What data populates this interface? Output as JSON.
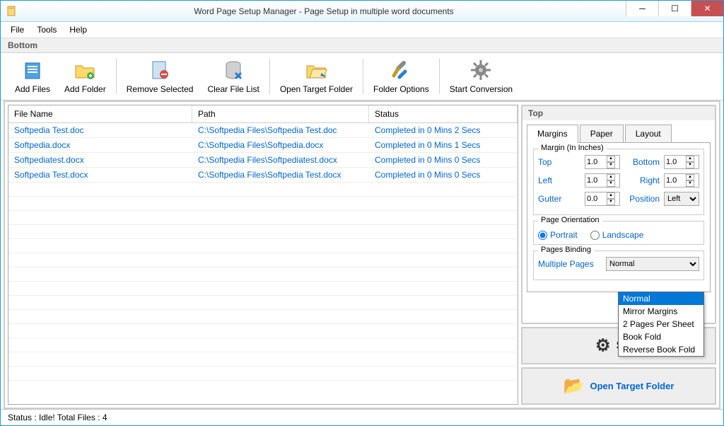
{
  "window": {
    "title": "Word Page Setup Manager - Page Setup in multiple word documents"
  },
  "menu": {
    "file": "File",
    "tools": "Tools",
    "help": "Help"
  },
  "section": {
    "bottom": "Bottom",
    "top": "Top"
  },
  "toolbar": {
    "add_files": "Add Files",
    "add_folder": "Add Folder",
    "remove_selected": "Remove Selected",
    "clear_file_list": "Clear File List",
    "open_target_folder": "Open Target Folder",
    "folder_options": "Folder Options",
    "start_conversion": "Start Conversion"
  },
  "grid": {
    "headers": {
      "file_name": "File Name",
      "path": "Path",
      "status": "Status"
    },
    "rows": [
      {
        "file": "Softpedia Test.doc",
        "path": "C:\\Softpedia Files\\Softpedia Test.doc",
        "status": "Completed in 0 Mins 2 Secs"
      },
      {
        "file": "Softpedia.docx",
        "path": "C:\\Softpedia Files\\Softpedia.docx",
        "status": "Completed in 0 Mins 1 Secs"
      },
      {
        "file": "Softpediatest.docx",
        "path": "C:\\Softpedia Files\\Softpediatest.docx",
        "status": "Completed in 0 Mins 0 Secs"
      },
      {
        "file": "Softpedia Test.docx",
        "path": "C:\\Softpedia Files\\Softpedia Test.docx",
        "status": "Completed in 0 Mins 0 Secs"
      }
    ]
  },
  "tabs": {
    "margins": "Margins",
    "paper": "Paper",
    "layout": "Layout"
  },
  "margins": {
    "group_title": "Margin (In Inches)",
    "top_lbl": "Top",
    "top_val": "1.0",
    "bottom_lbl": "Bottom",
    "bottom_val": "1.0",
    "left_lbl": "Left",
    "left_val": "1.0",
    "right_lbl": "Right",
    "right_val": "1.0",
    "gutter_lbl": "Gutter",
    "gutter_val": "0.0",
    "position_lbl": "Position",
    "position_val": "Left",
    "orientation_title": "Page Orientation",
    "portrait": "Portrait",
    "landscape": "Landscape",
    "binding_title": "Pages Binding",
    "mp_lbl": "Multiple Pages",
    "mp_val": "Normal",
    "mp_options": [
      "Normal",
      "Mirror Margins",
      "2 Pages Per Sheet",
      "Book Fold",
      "Reverse Book Fold"
    ]
  },
  "actions": {
    "start": "Start",
    "open_target": "Open Target Folder"
  },
  "status": "Status  :  Idle!  Total Files : 4"
}
